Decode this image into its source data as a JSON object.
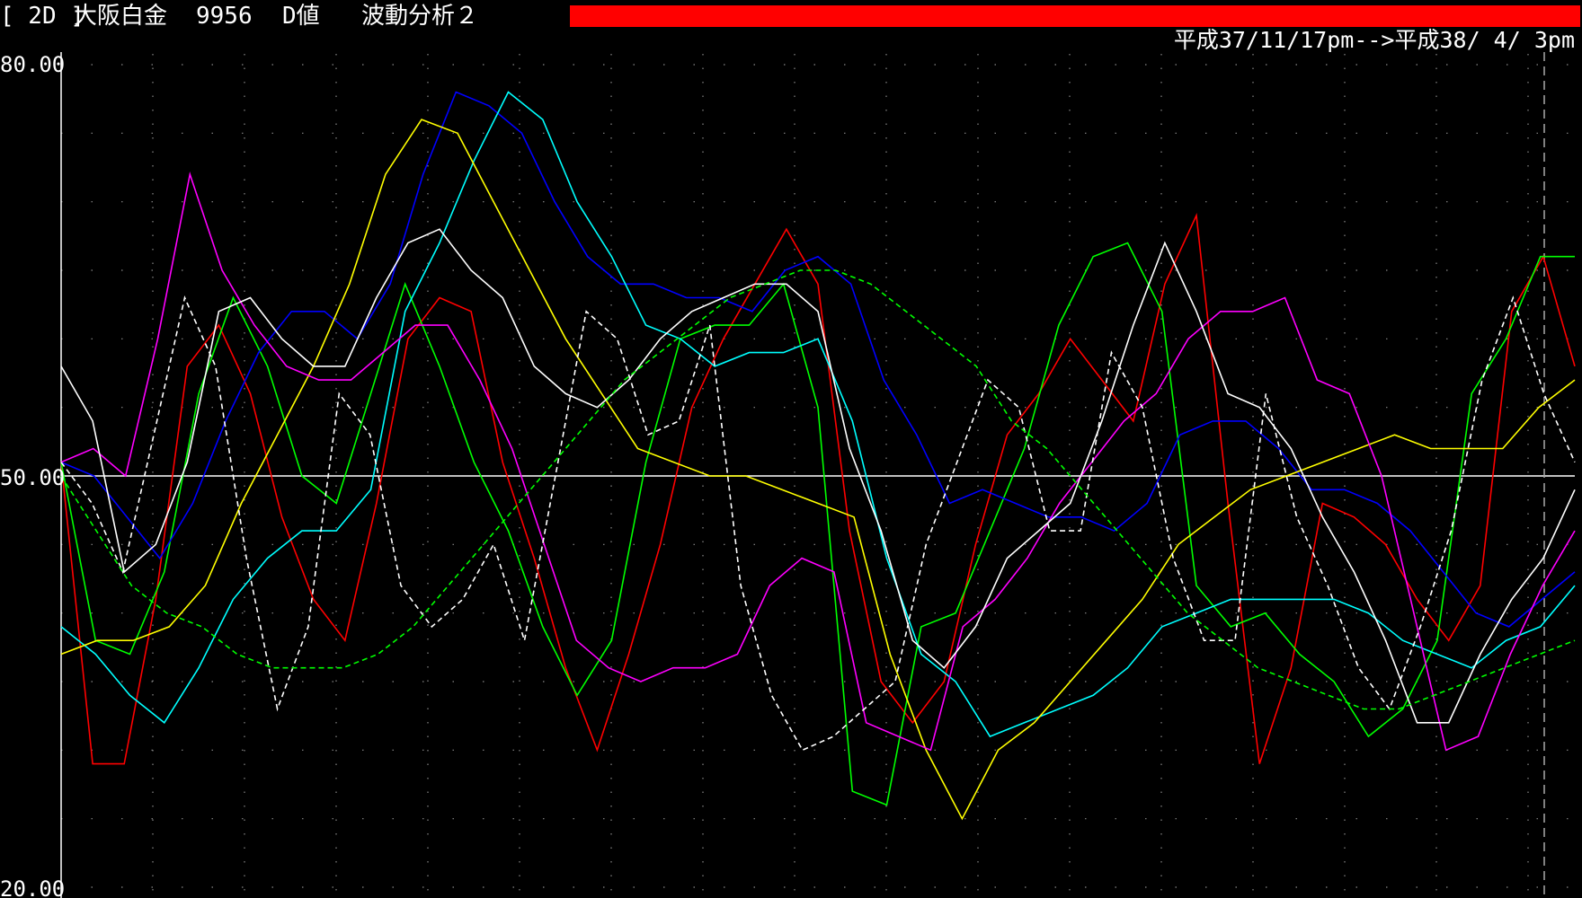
{
  "header": {
    "bracket": "[ 2D ]",
    "name": "大阪白金",
    "code": "9956",
    "value_type": "D値",
    "analysis": "波動分析２",
    "date_range": "平成37/11/17pm-->平成38/ 4/ 3pm",
    "bar_color": "#ff0000"
  },
  "chart_data": {
    "type": "line",
    "ylim": [
      20,
      80
    ],
    "yticks": [
      "80.00",
      "50.00",
      "20.00"
    ],
    "reference_line": 50,
    "grid": "dotted",
    "series": [
      {
        "color": "#ff0000",
        "style": "solid",
        "values": [
          51,
          29,
          29,
          41,
          58,
          61,
          56,
          47,
          41,
          38,
          48,
          60,
          63,
          62,
          51,
          44,
          36,
          30,
          37,
          45,
          55,
          60,
          64,
          68,
          64,
          46,
          35,
          32,
          35,
          45,
          53,
          56,
          60,
          57,
          54,
          64,
          69,
          48,
          29,
          36,
          48,
          47,
          45,
          41,
          38,
          42,
          62,
          66,
          58
        ]
      },
      {
        "color": "#00ff00",
        "style": "solid",
        "values": [
          51,
          38,
          37,
          43,
          56,
          63,
          58,
          50,
          48,
          56,
          64,
          58,
          51,
          46,
          39,
          34,
          38,
          51,
          60,
          61,
          61,
          64,
          55,
          27,
          26,
          39,
          40,
          46,
          52,
          61,
          66,
          67,
          62,
          42,
          39,
          40,
          37,
          35,
          31,
          33,
          38,
          56,
          60,
          66,
          66
        ]
      },
      {
        "color": "#0000ff",
        "style": "solid",
        "values": [
          51,
          50,
          47,
          44,
          48,
          54,
          59,
          62,
          62,
          60,
          64,
          72,
          78,
          77,
          75,
          70,
          66,
          64,
          64,
          63,
          63,
          62,
          65,
          66,
          64,
          57,
          53,
          48,
          49,
          48,
          47,
          47,
          46,
          48,
          53,
          54,
          54,
          52,
          49,
          49,
          48,
          46,
          43,
          40,
          39,
          41,
          43
        ]
      },
      {
        "color": "#00ffff",
        "style": "solid",
        "values": [
          39,
          37,
          34,
          32,
          36,
          41,
          44,
          46,
          46,
          49,
          62,
          67,
          73,
          78,
          76,
          70,
          66,
          61,
          60,
          58,
          59,
          59,
          60,
          54,
          44,
          37,
          35,
          31,
          32,
          33,
          34,
          36,
          39,
          40,
          41,
          41,
          41,
          41,
          40,
          38,
          37,
          36,
          38,
          39,
          42
        ]
      },
      {
        "color": "#ffff00",
        "style": "solid",
        "values": [
          37,
          38,
          38,
          39,
          42,
          48,
          53,
          58,
          64,
          72,
          76,
          75,
          70,
          65,
          60,
          56,
          52,
          51,
          50,
          50,
          49,
          48,
          47,
          37,
          30,
          25,
          30,
          32,
          35,
          38,
          41,
          45,
          47,
          49,
          50,
          51,
          52,
          53,
          52,
          52,
          52,
          55,
          57
        ]
      },
      {
        "color": "#ff00ff",
        "style": "solid",
        "values": [
          51,
          52,
          50,
          60,
          72,
          65,
          61,
          58,
          57,
          57,
          59,
          61,
          61,
          57,
          52,
          45,
          38,
          36,
          35,
          36,
          36,
          37,
          42,
          44,
          43,
          32,
          31,
          30,
          39,
          41,
          44,
          48,
          51,
          54,
          56,
          60,
          62,
          62,
          63,
          57,
          56,
          50,
          40,
          30,
          31,
          37,
          42,
          46
        ]
      },
      {
        "color": "#ffffff",
        "style": "solid",
        "values": [
          58,
          54,
          43,
          45,
          51,
          62,
          63,
          60,
          58,
          58,
          63,
          67,
          68,
          65,
          63,
          58,
          56,
          55,
          57,
          60,
          62,
          63,
          64,
          64,
          62,
          52,
          46,
          38,
          36,
          39,
          44,
          46,
          48,
          54,
          61,
          67,
          62,
          56,
          55,
          52,
          47,
          43,
          38,
          32,
          32,
          37,
          41,
          44,
          49
        ]
      },
      {
        "color": "#ffffff",
        "style": "dashed",
        "values": [
          51,
          48,
          43,
          53,
          63,
          58,
          44,
          33,
          39,
          56,
          53,
          42,
          39,
          41,
          45,
          38,
          50,
          62,
          60,
          53,
          54,
          61,
          42,
          34,
          30,
          31,
          33,
          35,
          45,
          51,
          57,
          55,
          46,
          46,
          59,
          55,
          44,
          38,
          38,
          56,
          47,
          42,
          36,
          33,
          39,
          46,
          57,
          63,
          56,
          51
        ]
      },
      {
        "color": "#00ff00",
        "style": "dashed",
        "values": [
          50,
          46,
          42,
          40,
          39,
          37,
          36,
          36,
          36,
          37,
          39,
          42,
          45,
          48,
          51,
          54,
          57,
          59,
          61,
          63,
          64,
          65,
          65,
          64,
          62,
          60,
          58,
          54,
          52,
          49,
          46,
          43,
          40,
          38,
          36,
          35,
          34,
          33,
          33,
          34,
          35,
          36,
          37,
          38
        ]
      }
    ]
  }
}
